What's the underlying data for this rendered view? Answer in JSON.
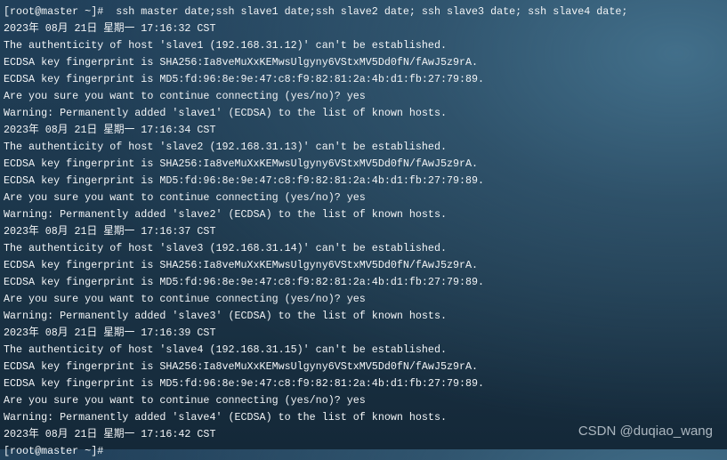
{
  "terminal": {
    "lines": [
      "[root@master ~]#  ssh master date;ssh slave1 date;ssh slave2 date; ssh slave3 date; ssh slave4 date;",
      "2023年 08月 21日 星期一 17:16:32 CST",
      "The authenticity of host 'slave1 (192.168.31.12)' can't be established.",
      "ECDSA key fingerprint is SHA256:Ia8veMuXxKEMwsUlgyny6VStxMV5Dd0fN/fAwJ5z9rA.",
      "ECDSA key fingerprint is MD5:fd:96:8e:9e:47:c8:f9:82:81:2a:4b:d1:fb:27:79:89.",
      "Are you sure you want to continue connecting (yes/no)? yes",
      "Warning: Permanently added 'slave1' (ECDSA) to the list of known hosts.",
      "2023年 08月 21日 星期一 17:16:34 CST",
      "The authenticity of host 'slave2 (192.168.31.13)' can't be established.",
      "ECDSA key fingerprint is SHA256:Ia8veMuXxKEMwsUlgyny6VStxMV5Dd0fN/fAwJ5z9rA.",
      "ECDSA key fingerprint is MD5:fd:96:8e:9e:47:c8:f9:82:81:2a:4b:d1:fb:27:79:89.",
      "Are you sure you want to continue connecting (yes/no)? yes",
      "Warning: Permanently added 'slave2' (ECDSA) to the list of known hosts.",
      "2023年 08月 21日 星期一 17:16:37 CST",
      "The authenticity of host 'slave3 (192.168.31.14)' can't be established.",
      "ECDSA key fingerprint is SHA256:Ia8veMuXxKEMwsUlgyny6VStxMV5Dd0fN/fAwJ5z9rA.",
      "ECDSA key fingerprint is MD5:fd:96:8e:9e:47:c8:f9:82:81:2a:4b:d1:fb:27:79:89.",
      "Are you sure you want to continue connecting (yes/no)? yes",
      "Warning: Permanently added 'slave3' (ECDSA) to the list of known hosts.",
      "2023年 08月 21日 星期一 17:16:39 CST",
      "The authenticity of host 'slave4 (192.168.31.15)' can't be established.",
      "ECDSA key fingerprint is SHA256:Ia8veMuXxKEMwsUlgyny6VStxMV5Dd0fN/fAwJ5z9rA.",
      "ECDSA key fingerprint is MD5:fd:96:8e:9e:47:c8:f9:82:81:2a:4b:d1:fb:27:79:89.",
      "Are you sure you want to continue connecting (yes/no)? yes",
      "Warning: Permanently added 'slave4' (ECDSA) to the list of known hosts.",
      "2023年 08月 21日 星期一 17:16:42 CST",
      "[root@master ~]#"
    ]
  },
  "watermark": "CSDN @duqiao_wang"
}
